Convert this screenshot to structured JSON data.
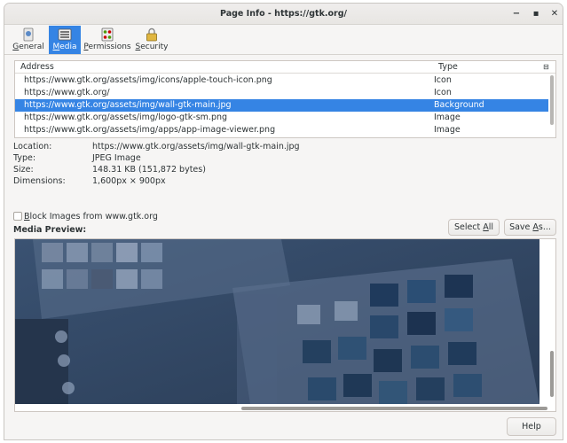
{
  "window": {
    "title": "Page Info - https://gtk.org/"
  },
  "tabs": [
    {
      "label": "General",
      "mnemonic": "G",
      "rest": "eneral",
      "icon": "page-icon"
    },
    {
      "label": "Media",
      "mnemonic": "M",
      "rest": "edia",
      "icon": "media-icon"
    },
    {
      "label": "Permissions",
      "mnemonic": "P",
      "rest": "ermissions",
      "icon": "permissions-icon"
    },
    {
      "label": "Security",
      "mnemonic": "S",
      "rest": "ecurity",
      "icon": "lock-icon"
    }
  ],
  "media_list": {
    "columns": {
      "address": "Address",
      "type": "Type"
    },
    "rows": [
      {
        "address": "https://www.gtk.org/assets/img/icons/apple-touch-icon.png",
        "type": "Icon",
        "selected": false
      },
      {
        "address": "https://www.gtk.org/",
        "type": "Icon",
        "selected": false
      },
      {
        "address": "https://www.gtk.org/assets/img/wall-gtk-main.jpg",
        "type": "Background",
        "selected": true
      },
      {
        "address": "https://www.gtk.org/assets/img/logo-gtk-sm.png",
        "type": "Image",
        "selected": false
      },
      {
        "address": "https://www.gtk.org/assets/img/apps/app-image-viewer.png",
        "type": "Image",
        "selected": false
      }
    ]
  },
  "properties": {
    "location_label": "Location:",
    "location_value": "https://www.gtk.org/assets/img/wall-gtk-main.jpg",
    "type_label": "Type:",
    "type_value": "JPEG Image",
    "size_label": "Size:",
    "size_value": "148.31 KB (151,872 bytes)",
    "dimensions_label": "Dimensions:",
    "dimensions_value": "1,600px × 900px"
  },
  "block_images": {
    "mnemonic": "B",
    "rest": "lock Images from www.gtk.org",
    "checked": false
  },
  "preview": {
    "label": "Media Preview:",
    "select_all": {
      "before": "Select ",
      "mnemonic": "A",
      "after": "ll"
    },
    "save_as": {
      "before": "Save ",
      "mnemonic": "A",
      "after": "s..."
    }
  },
  "help_button": "Help",
  "colors": {
    "accent": "#3584e4",
    "window_bg": "#f6f5f4",
    "preview_bg": "#30445f"
  }
}
